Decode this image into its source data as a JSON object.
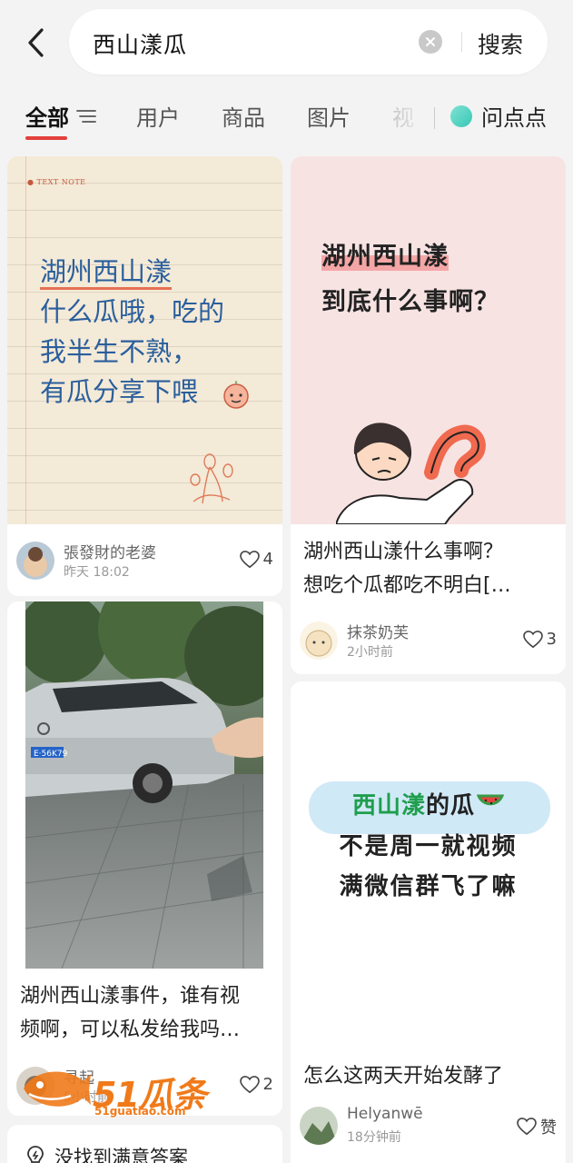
{
  "header": {
    "query": "西山漾瓜",
    "search_label": "搜索"
  },
  "tabs": [
    {
      "label": "全部",
      "active": true
    },
    {
      "label": "用户"
    },
    {
      "label": "商品"
    },
    {
      "label": "图片"
    },
    {
      "label": "视"
    }
  ],
  "wendian_label": "问点点",
  "cards": [
    {
      "cover_tag": "● TEXT NOTE",
      "cover_lines": [
        "湖州西山漾",
        "什么瓜哦，吃的",
        "我半生不熟，",
        "有瓜分享下喂"
      ],
      "user": "張發財的老婆",
      "time": "昨天 18:02",
      "likes": "4"
    },
    {
      "cover_lines": [
        "湖州西山漾",
        "到底什么事啊？"
      ],
      "title_lines": [
        "湖州西山漾什么事啊？",
        "想吃个瓜都吃不明白[…"
      ],
      "user": "抹茶奶芙",
      "time": "2小时前",
      "likes": "3"
    },
    {
      "plate": "E·56K79",
      "title_lines": [
        "湖州西山漾事件，谁有视",
        "频啊，可以私发给我吗…"
      ],
      "user": "寻起",
      "time": "5小时前",
      "likes": "2"
    },
    {
      "cover_line1_a": "西山漾",
      "cover_line1_b": "的瓜",
      "cover_line2": "不是周一就视频",
      "cover_line3": "满微信群飞了嘛",
      "title": "怎么这两天开始发酵了",
      "user": "Helyanwē",
      "time": "18分钟前",
      "likes": "赞"
    }
  ],
  "hint": "没找到满意答案",
  "watermark": {
    "brand": "51瓜条",
    "site": "51guatiao.com"
  },
  "colors": {
    "accent": "#e3403b",
    "note_blue": "#2a5f9c",
    "pink_bg": "#f8e3e3"
  }
}
